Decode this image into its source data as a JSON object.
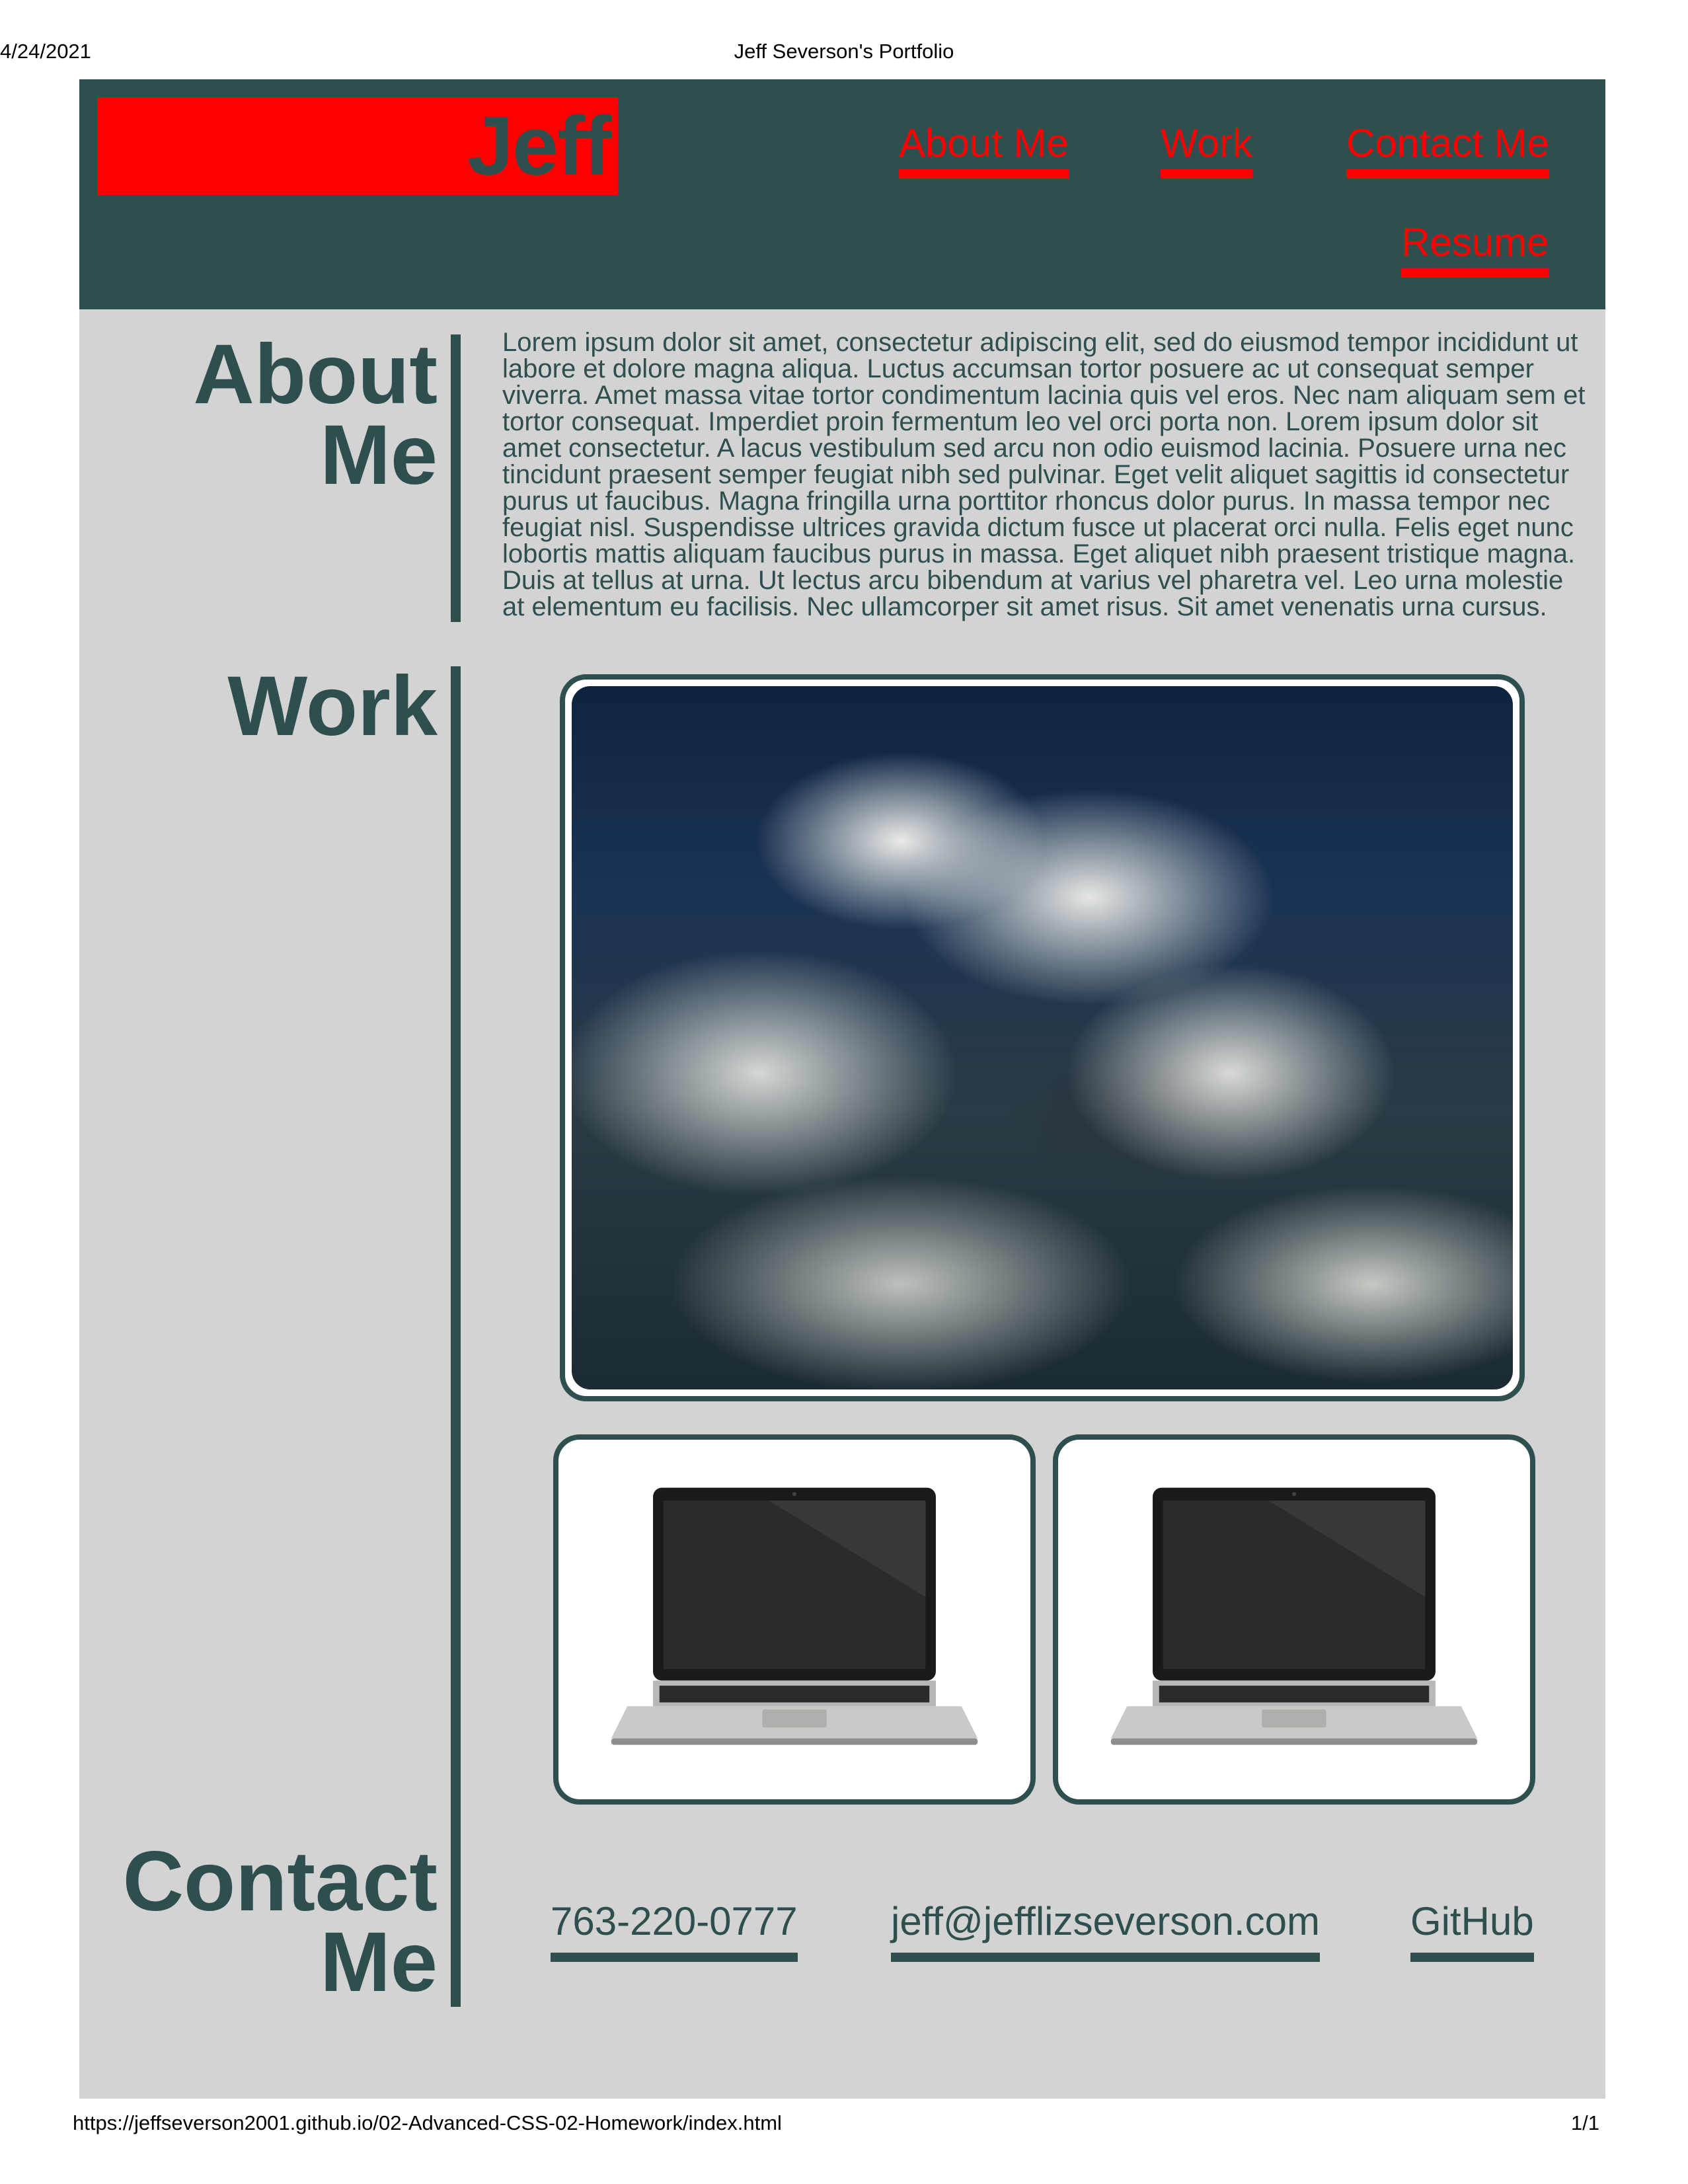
{
  "print": {
    "date": "4/24/2021",
    "title": "Jeff Severson's Portfolio",
    "url": "https://jeffseverson2001.github.io/02-Advanced-CSS-02-Homework/index.html",
    "page": "1/1"
  },
  "header": {
    "logo": "Jeff",
    "nav": {
      "about": "About Me",
      "work": "Work",
      "contact": "Contact Me",
      "resume": "Resume"
    }
  },
  "about": {
    "title_line1": "About",
    "title_line2": "Me",
    "text": "Lorem ipsum dolor sit amet, consectetur adipiscing elit, sed do eiusmod tempor incididunt ut labore et dolore magna aliqua. Luctus accumsan tortor posuere ac ut consequat semper viverra. Amet massa vitae tortor condimentum lacinia quis vel eros. Nec nam aliquam sem et tortor consequat. Imperdiet proin fermentum leo vel orci porta non. Lorem ipsum dolor sit amet consectetur. A lacus vestibulum sed arcu non odio euismod lacinia. Posuere urna nec tincidunt praesent semper feugiat nibh sed pulvinar. Eget velit aliquet sagittis id consectetur purus ut faucibus. Magna fringilla urna porttitor rhoncus dolor purus. In massa tempor nec feugiat nisl. Suspendisse ultrices gravida dictum fusce ut placerat orci nulla. Felis eget nunc lobortis mattis aliquam faucibus purus in massa. Eget aliquet nibh praesent tristique magna. Duis at tellus at urna. Ut lectus arcu bibendum at varius vel pharetra vel. Leo urna molestie at elementum eu facilisis. Nec ullamcorper sit amet risus. Sit amet venenatis urna cursus."
  },
  "work": {
    "title": "Work"
  },
  "contact": {
    "title_line1": "Contact",
    "title_line2": "Me",
    "phone": "763-220-0777",
    "email": "jeff@jefflizseverson.com",
    "github": "GitHub"
  },
  "colors": {
    "header_bg": "#2f4f4f",
    "accent": "#ff0000",
    "page_bg": "#d3d3d3"
  }
}
